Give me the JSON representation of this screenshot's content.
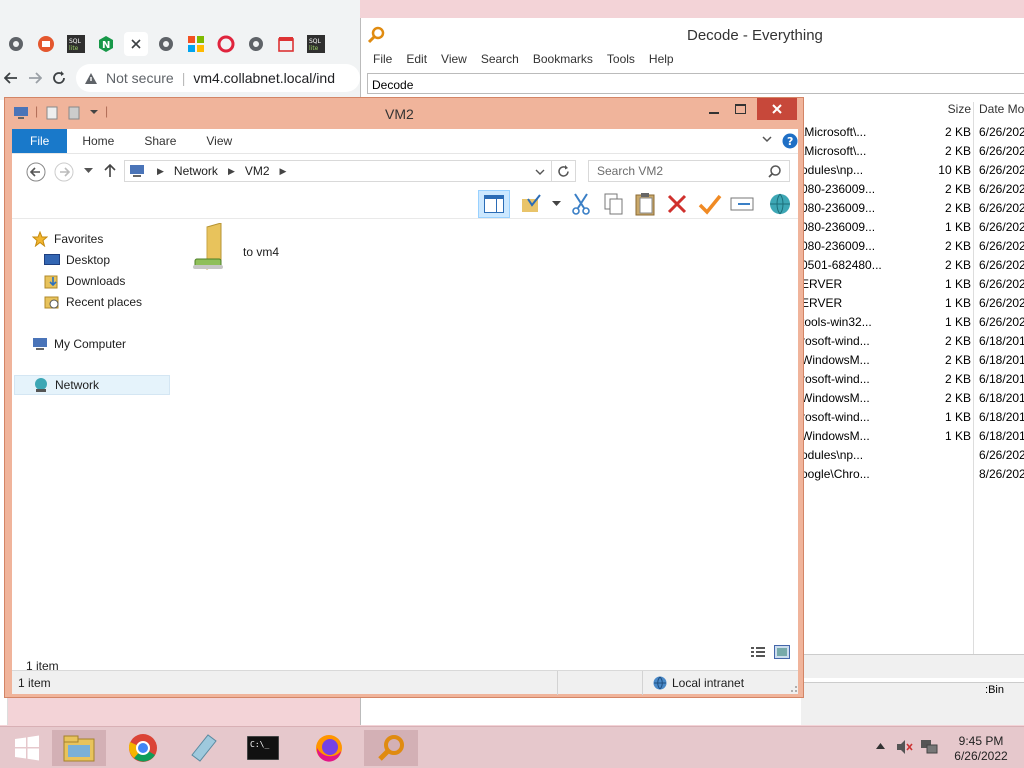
{
  "chrome": {
    "not_secure": "Not secure",
    "url": "vm4.collabnet.local/ind",
    "tab_labels": [
      "SQL lite",
      "SQL lite"
    ]
  },
  "everything": {
    "title": "Decode - Everything",
    "menu": [
      "File",
      "Edit",
      "View",
      "Search",
      "Bookmarks",
      "Tools",
      "Help"
    ],
    "search_value": "Decode",
    "columns": {
      "size": "Size",
      "date": "Date Mod"
    },
    "rows": [
      {
        "name": "\\Microsoft\\...",
        "size": "2 KB",
        "date": "6/26/202"
      },
      {
        "name": "\\Microsoft\\...",
        "size": "2 KB",
        "date": "6/26/202"
      },
      {
        "name": "odules\\np...",
        "size": "10 KB",
        "date": "6/26/202"
      },
      {
        "name": "080-236009...",
        "size": "2 KB",
        "date": "6/26/202"
      },
      {
        "name": "080-236009...",
        "size": "2 KB",
        "date": "6/26/202"
      },
      {
        "name": "080-236009...",
        "size": "1 KB",
        "date": "6/26/202"
      },
      {
        "name": "080-236009...",
        "size": "2 KB",
        "date": "6/26/202"
      },
      {
        "name": "0501-682480...",
        "size": "2 KB",
        "date": "6/26/202"
      },
      {
        "name": "ERVER",
        "size": "1 KB",
        "date": "6/26/202"
      },
      {
        "name": "ERVER",
        "size": "1 KB",
        "date": "6/26/202"
      },
      {
        "name": "tools-win32...",
        "size": "1 KB",
        "date": "6/26/202"
      },
      {
        "name": "rosoft-wind...",
        "size": "2 KB",
        "date": "6/18/201"
      },
      {
        "name": "WindowsM...",
        "size": "2 KB",
        "date": "6/18/201"
      },
      {
        "name": "rosoft-wind...",
        "size": "2 KB",
        "date": "6/18/201"
      },
      {
        "name": "WindowsM...",
        "size": "2 KB",
        "date": "6/18/201"
      },
      {
        "name": "rosoft-wind...",
        "size": "1 KB",
        "date": "6/18/201"
      },
      {
        "name": "WindowsM...",
        "size": "1 KB",
        "date": "6/18/201"
      },
      {
        "name": "odules\\np...",
        "size": "",
        "date": "6/26/202"
      },
      {
        "name": "oogle\\Chro...",
        "size": "",
        "date": "8/26/202"
      }
    ],
    "bin_label": "Bin"
  },
  "explorer": {
    "title": "VM2",
    "ribbon_tabs": [
      "File",
      "Home",
      "Share",
      "View"
    ],
    "breadcrumb": [
      "Network",
      "VM2"
    ],
    "search_placeholder": "Search VM2",
    "nav": {
      "favorites": "Favorites",
      "desktop": "Desktop",
      "downloads": "Downloads",
      "recent": "Recent places",
      "computer": "My Computer",
      "network": "Network"
    },
    "items": [
      {
        "name": "to vm4",
        "type": "mapped-folder"
      }
    ],
    "item_count": "1 item",
    "statusbar_count": "1 item",
    "zone": "Local intranet"
  },
  "taskbar": {
    "time": "9:45 PM",
    "date": "6/26/2022"
  },
  "colors": {
    "explorer_frame": "#f0b49b",
    "close_button": "#c7483a",
    "file_tab": "#1979ca",
    "taskbar": "#e6c8cc"
  }
}
